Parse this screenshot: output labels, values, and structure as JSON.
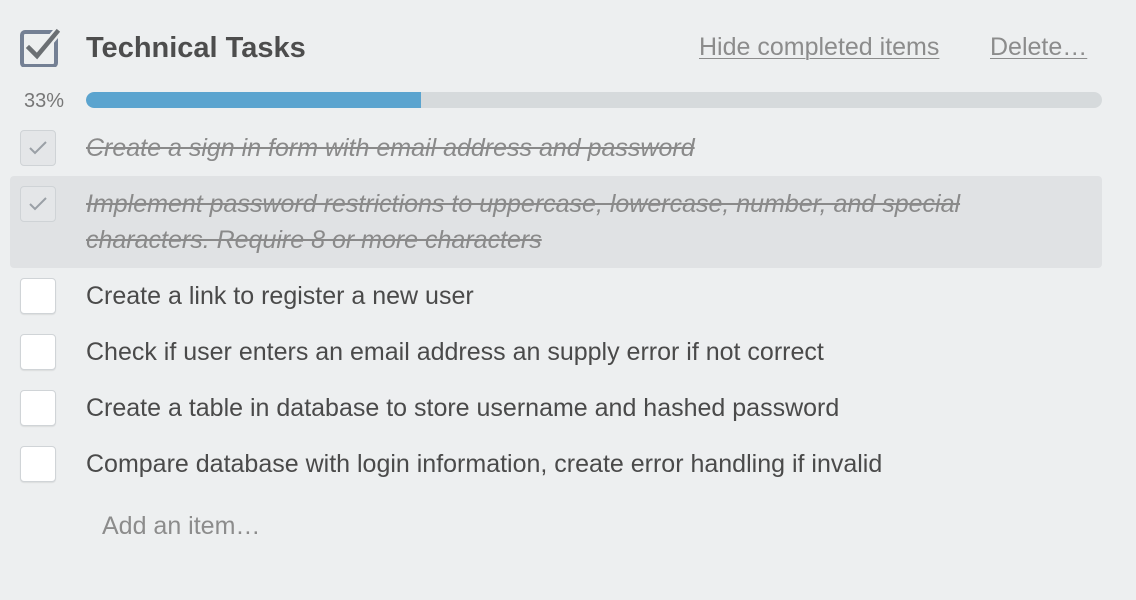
{
  "checklist": {
    "title": "Technical Tasks",
    "hide_completed_label": "Hide completed items",
    "delete_label": "Delete…",
    "progress": {
      "label": "33%",
      "value": 33
    },
    "items": [
      {
        "text": "Create a sign in form with email address and password",
        "completed": true
      },
      {
        "text_line1": "Implement password restrictions to uppercase, lowercase, number, and special",
        "text_line2": "characters. Require 8 or more characters",
        "completed": true
      },
      {
        "text": "Create a link to register a new user",
        "completed": false
      },
      {
        "text": "Check if user enters an email address an supply error if not correct",
        "completed": false
      },
      {
        "text": "Create a table in database to store username and hashed password",
        "completed": false
      },
      {
        "text": "Compare database with login information, create error handling if invalid",
        "completed": false
      }
    ],
    "add_item_placeholder": "Add an item…"
  },
  "colors": {
    "background": "#edeff0",
    "progress_fill": "#5ba4cf",
    "progress_track": "#d6dadc"
  },
  "icons": {
    "header": "checklist-icon",
    "checked": "checkmark-icon"
  }
}
